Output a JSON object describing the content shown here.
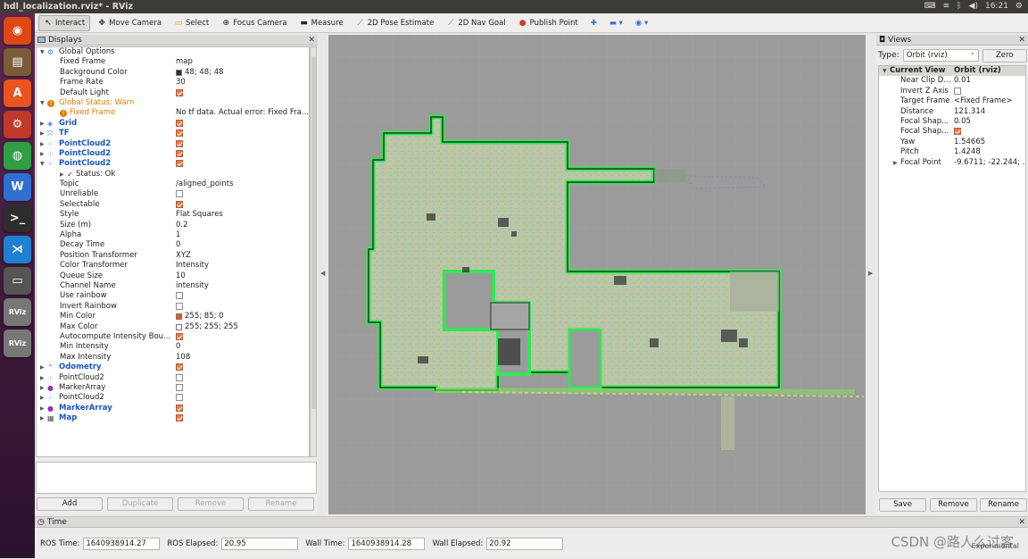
{
  "window": {
    "title": "hdl_localization.rviz* - RViz"
  },
  "systray": {
    "clock": "16:21",
    "battery": "◀)",
    "icons": [
      "keyboard-icon",
      "wifi-icon",
      "bluetooth-icon",
      "volume-icon",
      "battery-icon",
      "settings-gear-icon"
    ]
  },
  "launcher": {
    "items": [
      {
        "name": "ubuntu-dash-icon",
        "glyph": "◉",
        "color": "#dd4814"
      },
      {
        "name": "files-icon",
        "glyph": "▤",
        "color": "#7a5c3a"
      },
      {
        "name": "software-center-icon",
        "glyph": "A",
        "color": "#e95420"
      },
      {
        "name": "system-settings-icon",
        "glyph": "⚙",
        "color": "#c0392b"
      },
      {
        "name": "chrome-icon",
        "glyph": "◍",
        "color": "#2f9e44"
      },
      {
        "name": "wps-writer-icon",
        "glyph": "W",
        "color": "#2f6fd1"
      },
      {
        "name": "terminal-icon",
        "glyph": ">_",
        "color": "#2d2d2d"
      },
      {
        "name": "vscode-icon",
        "glyph": "⋊",
        "color": "#1f7fd1"
      },
      {
        "name": "screenshot-icon",
        "glyph": "▭",
        "color": "#555555"
      },
      {
        "name": "rviz-icon",
        "glyph": "RViz",
        "color": "#777777"
      },
      {
        "name": "rviz-icon-2",
        "glyph": "RViz",
        "color": "#777777"
      }
    ]
  },
  "toolbar": {
    "tools": [
      {
        "name": "interact-tool",
        "label": "Interact",
        "icon": "↖",
        "active": true
      },
      {
        "name": "move-camera-tool",
        "label": "Move Camera",
        "icon": "✥",
        "active": false
      },
      {
        "name": "select-tool",
        "label": "Select",
        "icon": "▭",
        "active": false
      },
      {
        "name": "focus-camera-tool",
        "label": "Focus Camera",
        "icon": "⊕",
        "active": false
      },
      {
        "name": "measure-tool",
        "label": "Measure",
        "icon": "▬",
        "active": false
      },
      {
        "name": "pose-estimate-tool",
        "label": "2D Pose Estimate",
        "icon": "⟋",
        "active": false
      },
      {
        "name": "nav-goal-tool",
        "label": "2D Nav Goal",
        "icon": "⟋",
        "active": false
      },
      {
        "name": "publish-point-tool",
        "label": "Publish Point",
        "icon": "●",
        "active": false
      }
    ],
    "extra_icons": [
      "add-tool-icon",
      "minus-tool-icon",
      "camera-type-icon"
    ]
  },
  "displays": {
    "title": "Displays",
    "rows": [
      {
        "indent": 0,
        "arrow": "▼",
        "icon": "⚙",
        "icon_color": "#3c7bd6",
        "name": "Global Options",
        "style": "",
        "value": ""
      },
      {
        "indent": 1,
        "name": "Fixed Frame",
        "value": "map"
      },
      {
        "indent": 1,
        "name": "Background Color",
        "value": "48; 48; 48",
        "swatch": "#303030"
      },
      {
        "indent": 1,
        "name": "Frame Rate",
        "value": "30"
      },
      {
        "indent": 1,
        "name": "Default Light",
        "check": true
      },
      {
        "indent": 0,
        "arrow": "▼",
        "icon": "!",
        "icon_color": "#e07b00",
        "name": "Global Status: Warn",
        "style": "orange",
        "value": ""
      },
      {
        "indent": 1,
        "icon": "!",
        "icon_color": "#e07b00",
        "name": "Fixed Frame",
        "style": "orange",
        "value": "No tf data.  Actual error: Fixed Fra..."
      },
      {
        "indent": 0,
        "arrow": "▶",
        "icon": "◈",
        "icon_color": "#3c7bd6",
        "name": "Grid",
        "style": "blue",
        "check": true
      },
      {
        "indent": 0,
        "arrow": "▶",
        "icon": "⤧",
        "icon_color": "#3c7bd6",
        "name": "TF",
        "style": "blue",
        "check": true
      },
      {
        "indent": 0,
        "arrow": "▶",
        "icon": "⁘",
        "icon_color": "#3c7bd6",
        "name": "PointCloud2",
        "style": "blue",
        "check": true
      },
      {
        "indent": 0,
        "arrow": "▶",
        "icon": "⁘",
        "icon_color": "#3c7bd6",
        "name": "PointCloud2",
        "style": "blue",
        "check": true
      },
      {
        "indent": 0,
        "arrow": "▼",
        "icon": "⁘",
        "icon_color": "#3c7bd6",
        "name": "PointCloud2",
        "style": "blue",
        "check": true
      },
      {
        "indent": 1,
        "arrow": "▶",
        "icon": "✓",
        "icon_color": "#222",
        "name": "Status: Ok",
        "value": ""
      },
      {
        "indent": 1,
        "name": "Topic",
        "value": "/aligned_points"
      },
      {
        "indent": 1,
        "name": "Unreliable",
        "check": false
      },
      {
        "indent": 1,
        "name": "Selectable",
        "check": true
      },
      {
        "indent": 1,
        "name": "Style",
        "value": "Flat Squares"
      },
      {
        "indent": 1,
        "name": "Size (m)",
        "value": "0.2"
      },
      {
        "indent": 1,
        "name": "Alpha",
        "value": "1"
      },
      {
        "indent": 1,
        "name": "Decay Time",
        "value": "0"
      },
      {
        "indent": 1,
        "name": "Position Transformer",
        "value": "XYZ"
      },
      {
        "indent": 1,
        "name": "Color Transformer",
        "value": "Intensity"
      },
      {
        "indent": 1,
        "name": "Queue Size",
        "value": "10"
      },
      {
        "indent": 1,
        "name": "Channel Name",
        "value": "intensity"
      },
      {
        "indent": 1,
        "name": "Use rainbow",
        "check": false
      },
      {
        "indent": 1,
        "name": "Invert Rainbow",
        "check": false
      },
      {
        "indent": 1,
        "name": "Min Color",
        "value": "255; 85; 0",
        "swatch": "#ff5500"
      },
      {
        "indent": 1,
        "name": "Max Color",
        "value": "255; 255; 255",
        "swatch": "#ffffff"
      },
      {
        "indent": 1,
        "name": "Autocompute Intensity Bou...",
        "check": true
      },
      {
        "indent": 1,
        "name": "Min Intensity",
        "value": "0"
      },
      {
        "indent": 1,
        "name": "Max Intensity",
        "value": "108"
      },
      {
        "indent": 0,
        "arrow": "▶",
        "icon": "⌃",
        "icon_color": "#d6402d",
        "name": "Odometry",
        "style": "blue",
        "check": true
      },
      {
        "indent": 0,
        "arrow": "▶",
        "icon": "⁘",
        "icon_color": "#3c7bd6",
        "name": "PointCloud2",
        "style": "",
        "check": false
      },
      {
        "indent": 0,
        "arrow": "▶",
        "icon": "●",
        "icon_color": "#9b2dba",
        "name": "MarkerArray",
        "style": "",
        "check": false
      },
      {
        "indent": 0,
        "arrow": "▶",
        "icon": "⁘",
        "icon_color": "#3c7bd6",
        "name": "PointCloud2",
        "style": "",
        "check": false
      },
      {
        "indent": 0,
        "arrow": "▶",
        "icon": "●",
        "icon_color": "#9b2dba",
        "name": "MarkerArray",
        "style": "blue",
        "check": true
      },
      {
        "indent": 0,
        "arrow": "▶",
        "icon": "▦",
        "icon_color": "#555",
        "name": "Map",
        "style": "blue",
        "check": true
      }
    ],
    "buttons": {
      "add": "Add",
      "duplicate": "Duplicate",
      "remove": "Remove",
      "rename": "Rename"
    }
  },
  "views": {
    "title": "Views",
    "type_label": "Type:",
    "type_value": "Orbit (rviz)",
    "zero": "Zero",
    "header": {
      "name": "Current View",
      "value": "Orbit (rviz)"
    },
    "rows": [
      {
        "name": "Near Clip D...",
        "value": "0.01"
      },
      {
        "name": "Invert Z Axis",
        "check": false
      },
      {
        "name": "Target Frame",
        "value": "<Fixed Frame>"
      },
      {
        "name": "Distance",
        "value": "121.314"
      },
      {
        "name": "Focal Shap...",
        "value": "0.05"
      },
      {
        "name": "Focal Shap...",
        "check": true
      },
      {
        "name": "Yaw",
        "value": "1.54665"
      },
      {
        "name": "Pitch",
        "value": "1.4248"
      },
      {
        "name": "Focal Point",
        "value": "-9.6711; -22.244; ...",
        "arrow": "▶"
      }
    ],
    "buttons": {
      "save": "Save",
      "remove": "Remove",
      "rename": "Rename"
    }
  },
  "time": {
    "title": "Time",
    "ros_time_label": "ROS Time:",
    "ros_time": "1640938914.27",
    "ros_elapsed_label": "ROS Elapsed:",
    "ros_elapsed": "20.95",
    "wall_time_label": "Wall Time:",
    "wall_time": "1640938914.28",
    "wall_elapsed_label": "Wall Elapsed:",
    "wall_elapsed": "20.92",
    "experimental": "Experimental"
  },
  "watermark": "CSDN @路人么过客"
}
